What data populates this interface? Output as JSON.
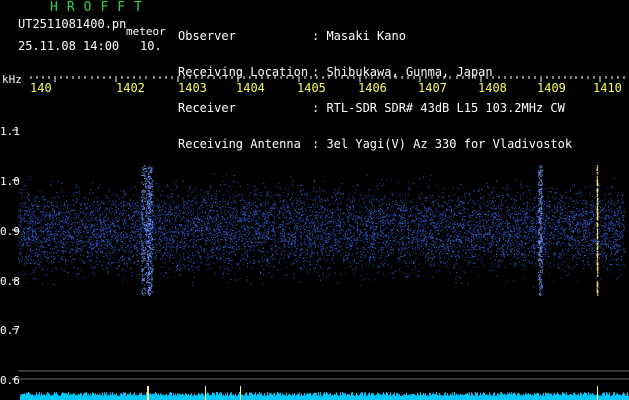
{
  "header": {
    "title": "HROFFT",
    "file_name": "UT2511081400.pn",
    "mode": "meteor",
    "datetime": "25.11.08 14:00",
    "interval": "10."
  },
  "station_info": {
    "labels": [
      "Observer",
      "Receiving Location",
      "Receiver",
      "Receiving Antenna"
    ],
    "values": [
      ": Masaki Kano",
      ": Shibukawa, Gunma, Japan",
      ": RTL-SDR SDR# 43dB L15 103.2MHz CW",
      ": 3el Yagi(V) Az 330 for Vladivostok"
    ]
  },
  "axes": {
    "y_unit": "kHz",
    "y_ticks": [
      "1.1",
      "1.0",
      "0.9",
      "0.8",
      "0.7",
      "0.6"
    ],
    "x_labels": [
      "140",
      "1402",
      "1403",
      "1404",
      "1405",
      "1406",
      "1407",
      "1408",
      "1409",
      "1410"
    ]
  },
  "colors": {
    "background": "#000000",
    "title": "#2fd24f",
    "text": "#ffffff",
    "freq_labels": "#ffff55",
    "signal": "#2a55ff",
    "baseline": "#00c8ff"
  }
}
